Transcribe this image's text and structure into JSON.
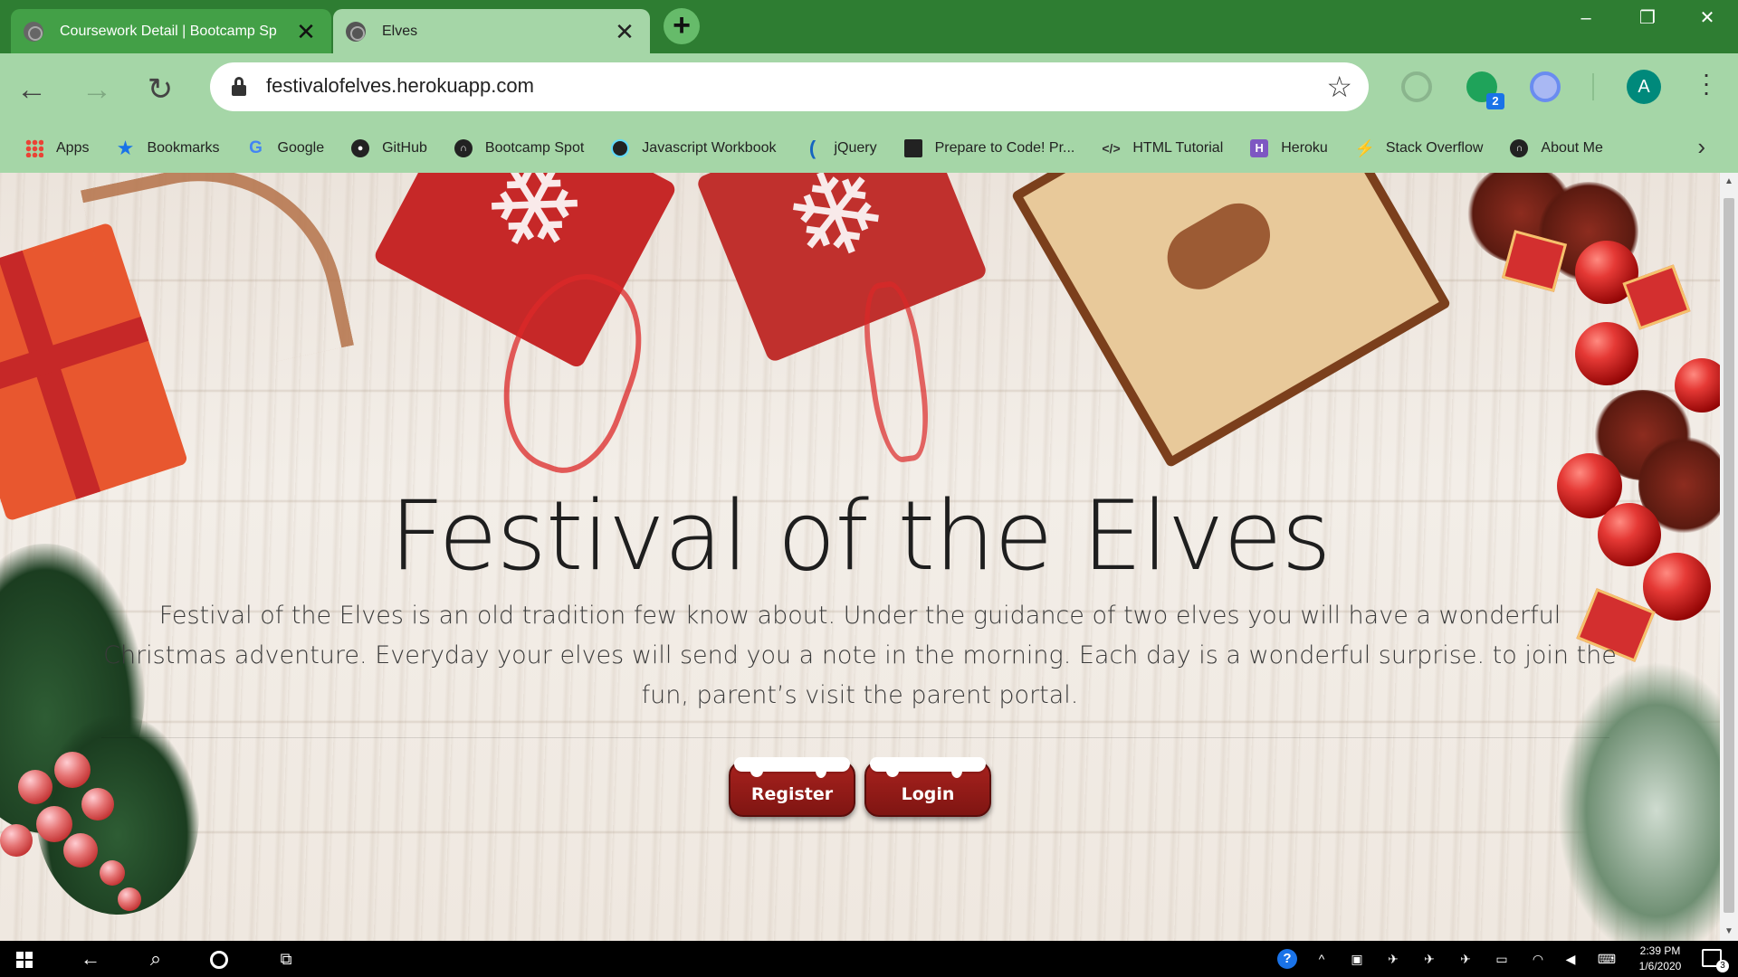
{
  "browser": {
    "tabs": [
      {
        "title": "Coursework Detail | Bootcamp Sp",
        "active": false
      },
      {
        "title": "Elves",
        "active": true
      }
    ],
    "new_tab_symbol": "+",
    "window_controls": {
      "minimize": "–",
      "maximize": "❐",
      "close": "✕"
    },
    "url": "festivalofelves.herokuapp.com",
    "profile_initial": "A",
    "extension_badge": "2",
    "bookmarks": [
      {
        "label": "Apps",
        "icon": "apps-grid-icon"
      },
      {
        "label": "Bookmarks",
        "icon": "star-icon"
      },
      {
        "label": "Google",
        "icon": "google-icon"
      },
      {
        "label": "GitHub",
        "icon": "github-icon"
      },
      {
        "label": "Bootcamp Spot",
        "icon": "bootcamp-spot-icon"
      },
      {
        "label": "Javascript Workbook",
        "icon": "react-icon"
      },
      {
        "label": "jQuery",
        "icon": "jquery-icon"
      },
      {
        "label": "Prepare to Code! Pr...",
        "icon": "book-icon"
      },
      {
        "label": "HTML Tutorial",
        "icon": "code-icon"
      },
      {
        "label": "Heroku",
        "icon": "heroku-icon"
      },
      {
        "label": "Stack Overflow",
        "icon": "stack-overflow-icon"
      },
      {
        "label": "About Me",
        "icon": "bootcamp-spot-icon"
      }
    ]
  },
  "page": {
    "title": "Festival of the Elves",
    "description": "Festival of the Elves is an old tradition few know about. Under the guidance of two elves you will have a wonderful Christmas adventure. Everyday your elves will send you a note in the morning. Each day is a wonderful surprise. to join the fun, parent’s visit the parent portal.",
    "buttons": {
      "register": "Register",
      "login": "Login"
    },
    "colors": {
      "button_red": "#a8221e",
      "title_text": "#1e1e1e"
    }
  },
  "taskbar": {
    "time": "2:39 PM",
    "date": "1/6/2020",
    "notification_count": "3"
  }
}
